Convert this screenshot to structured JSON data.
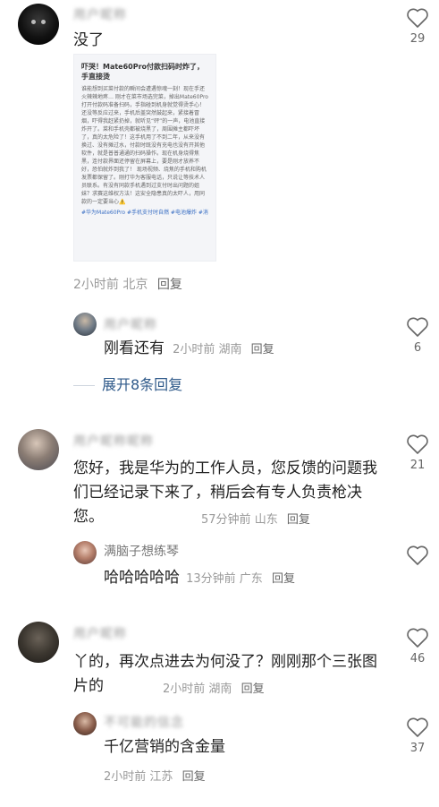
{
  "comments": [
    {
      "username": "用户昵称",
      "text": "没了",
      "time": "2小时前",
      "location": "北京",
      "reply": "回复",
      "likes": "29",
      "post": {
        "title": "吓哭！Mate60Pro付款扫码时炸了，手直接烫",
        "body": "谁能想到买菜付款的瞬间会遭遇惊魂一刻！现在手还火辣辣地疼… 刚才在菜市场选完菜，掉出Mate60Pro打开付款码准备扫码，手指碰到机身就觉得烫手心！还没等反应过来，手机后盖突然鼓起来，紧接着冒烟，吓得我赶紧扔掉，就听见“砰”的一声，电池直接炸开了。菜和手机壳都被烧黑了，周围摊主都吓坏了，真的太危险了！这手机用了不到二年，从来没有换过、没有摊过水，付款时既没有充电也没有开其他软件，就是普普通通的扫码操作。现在机身烧得焦黑，连付款界面还停留在屏幕上，要是刚才放养不好，恐怕就炸到我了！ 现场视频、烧焦的手机和购机发票都保留了。刚打华为客服电话，只说让等技术人员联系。有没有同款手机遇到过支付时出问题的姐妹？求赛这维权方法！这安全隐患真的太吓人，用同款的一定要当心⚠️",
        "tags": "#华为Mate60Pro #手机支付时自燃 #电池爆炸 #消"
      },
      "replies": [
        {
          "username": "用户昵称",
          "text": "刚看还有",
          "time": "2小时前",
          "location": "湖南",
          "reply": "回复",
          "likes": "6"
        }
      ],
      "expand": "展开8条回复"
    },
    {
      "username": "用户昵称昵称",
      "text": "您好，我是华为的工作人员，您反馈的问题我们已经记录下来了，稍后会有专人负责枪决您。",
      "time": "57分钟前",
      "location": "山东",
      "reply": "回复",
      "likes": "21",
      "replies": [
        {
          "username": "满脑子想练琴",
          "text": "哈哈哈哈哈",
          "time": "13分钟前",
          "location": "广东",
          "reply": "回复",
          "likes": ""
        }
      ]
    },
    {
      "username": "用户昵称",
      "text": "丫的，再次点进去为何没了？刚刚那个三张图片的",
      "time": "2小时前",
      "location": "湖南",
      "reply": "回复",
      "likes": "46",
      "replies": [
        {
          "username": "不可能的信念",
          "text": "千亿营销的含金量",
          "time": "2小时前",
          "location": "江苏",
          "reply": "回复",
          "likes": "37"
        }
      ]
    }
  ],
  "colors": {
    "link": "#2f5a8a",
    "meta": "#999999",
    "text": "#222222"
  }
}
